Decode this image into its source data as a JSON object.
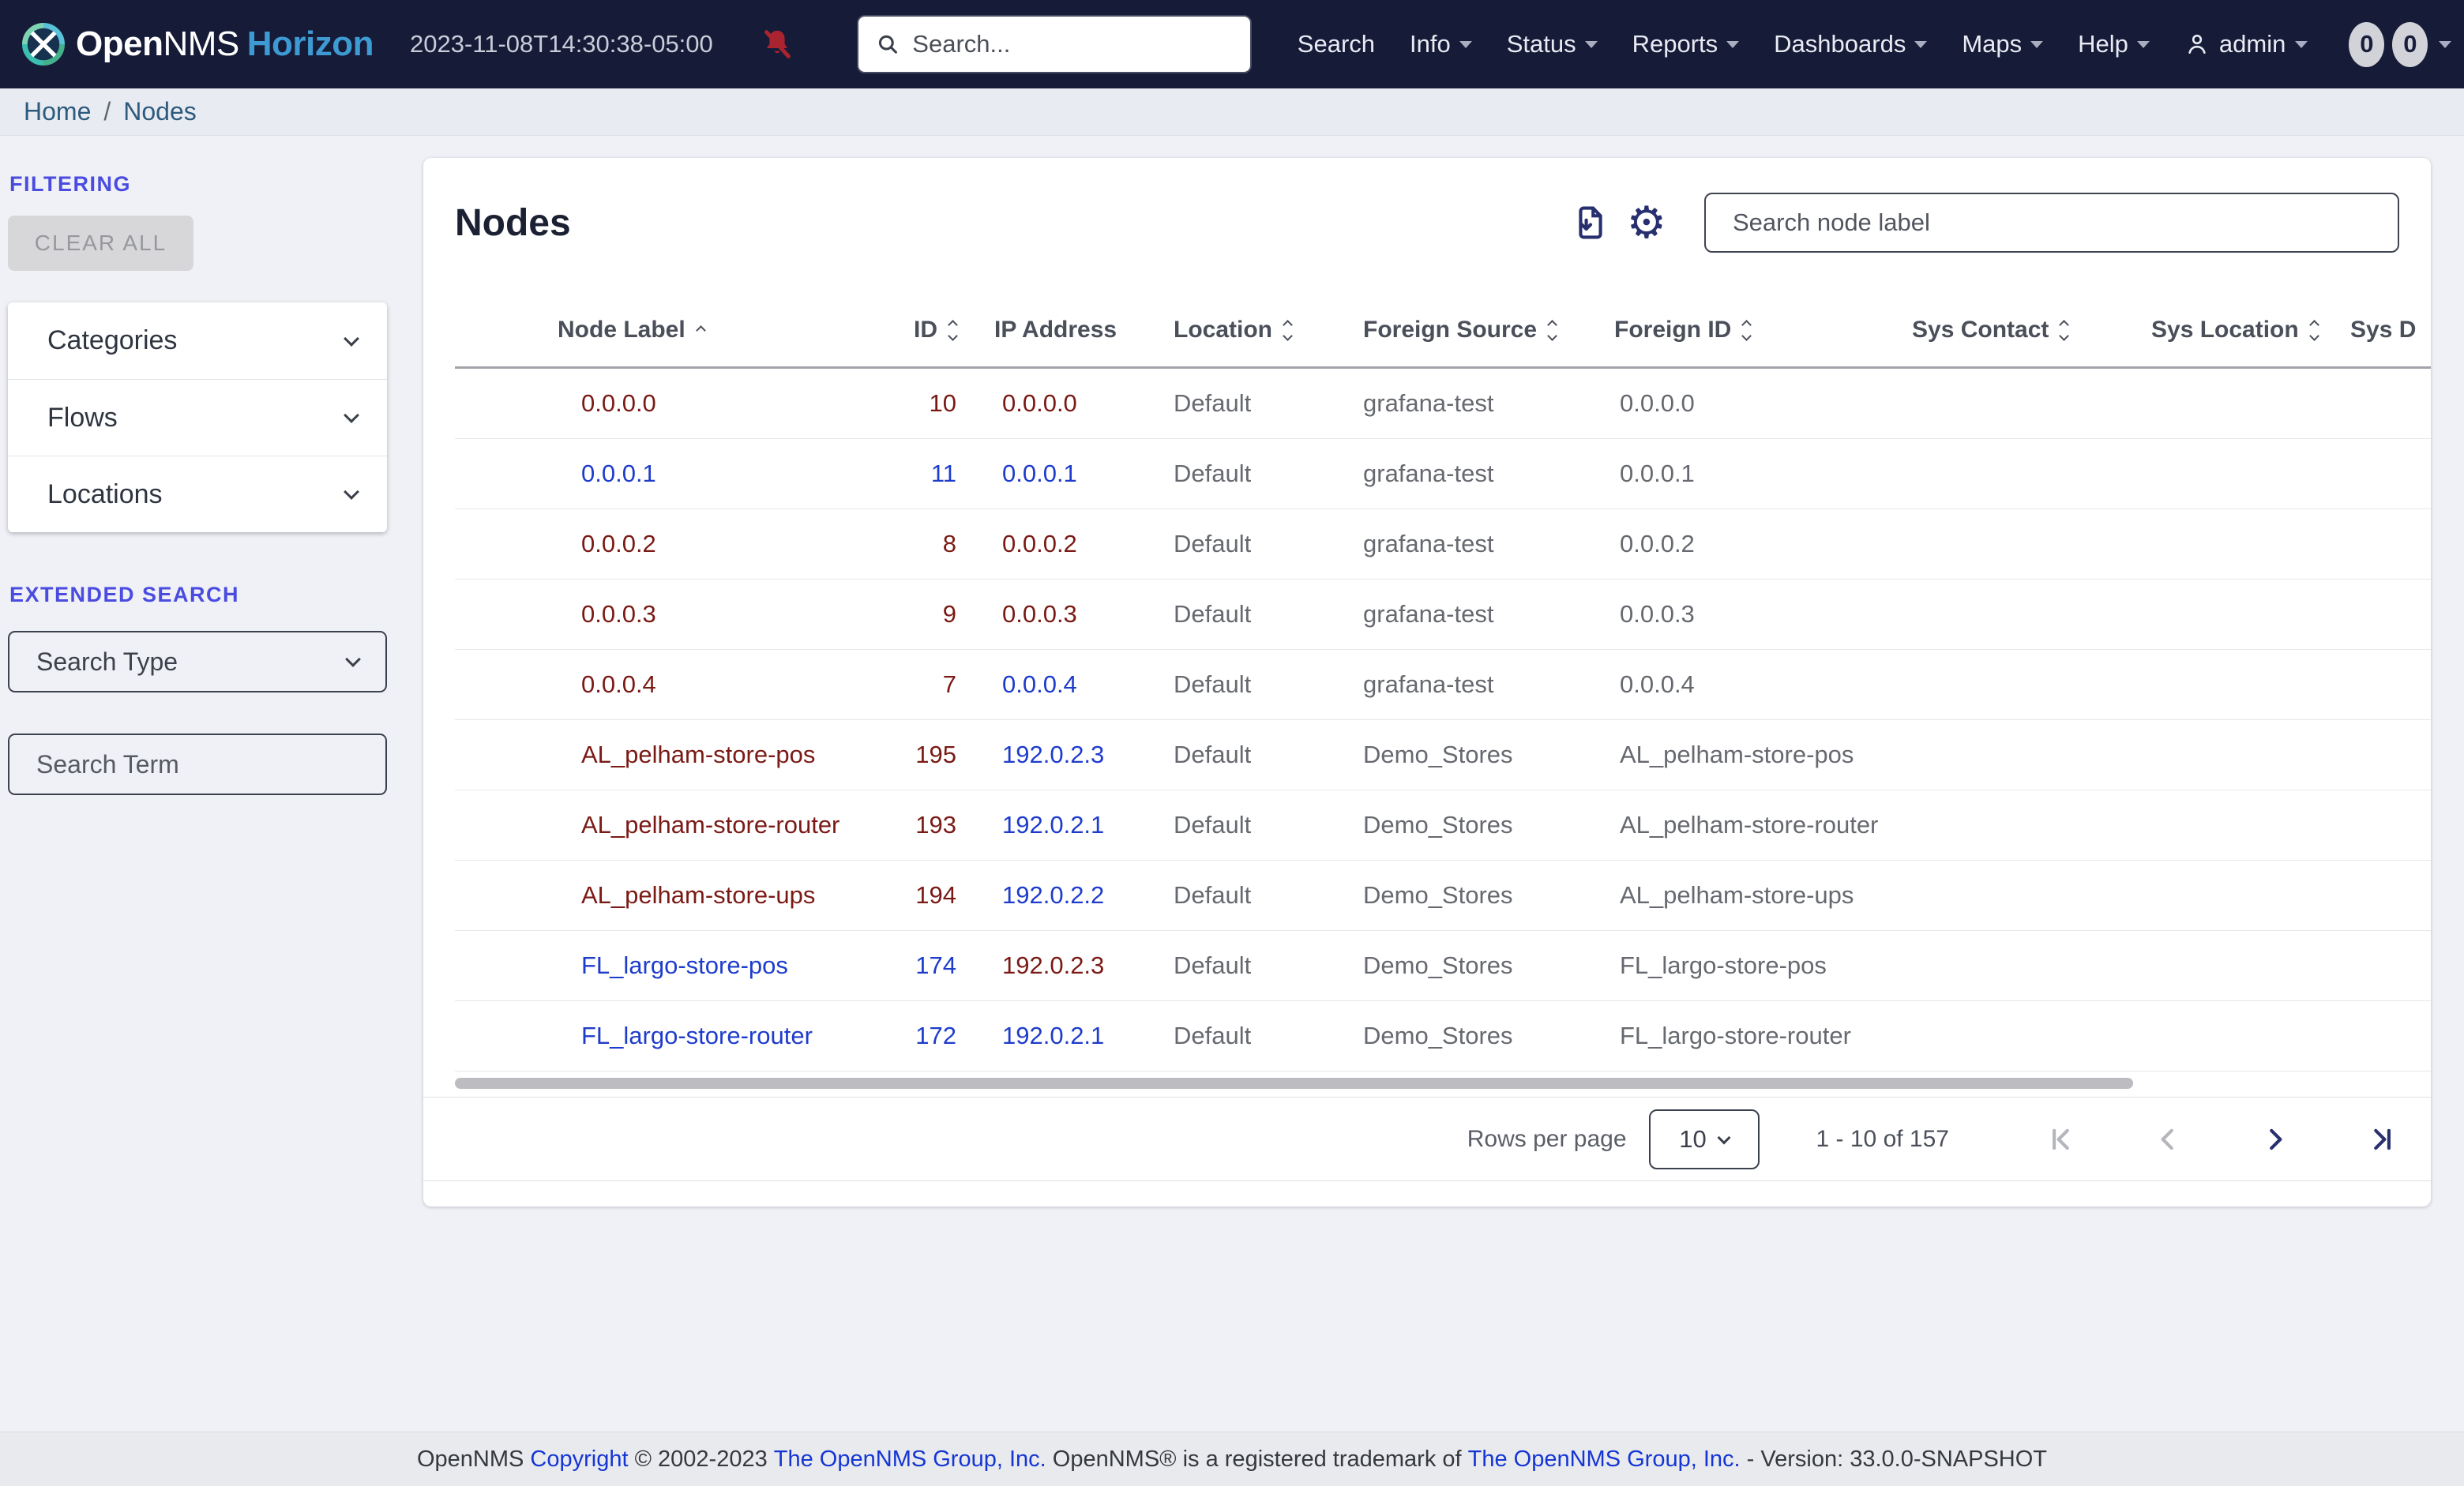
{
  "nav": {
    "brand": {
      "open": "Open",
      "nms": "NMS",
      "product": "Horizon"
    },
    "timestamp": "2023-11-08T14:30:38-05:00",
    "search_placeholder": "Search...",
    "menu": [
      {
        "label": "Search",
        "caret": false
      },
      {
        "label": "Info",
        "caret": true
      },
      {
        "label": "Status",
        "caret": true
      },
      {
        "label": "Reports",
        "caret": true
      },
      {
        "label": "Dashboards",
        "caret": true
      },
      {
        "label": "Maps",
        "caret": true
      },
      {
        "label": "Help",
        "caret": true
      }
    ],
    "user": {
      "label": "admin"
    },
    "badges": [
      "0",
      "0"
    ]
  },
  "breadcrumb": {
    "home": "Home",
    "separator": "/",
    "current": "Nodes"
  },
  "sidebar": {
    "filtering_label": "FILTERING",
    "clear_all_label": "CLEAR ALL",
    "accordions": [
      {
        "label": "Categories"
      },
      {
        "label": "Flows"
      },
      {
        "label": "Locations"
      }
    ],
    "extended_search_label": "EXTENDED SEARCH",
    "search_type_label": "Search Type",
    "search_term_placeholder": "Search Term"
  },
  "main": {
    "title": "Nodes",
    "node_search_placeholder": "Search node label",
    "table": {
      "columns": [
        {
          "label": "Node Label",
          "sort": "asc",
          "align": "left"
        },
        {
          "label": "ID",
          "sort": "both",
          "align": "right"
        },
        {
          "label": "IP Address",
          "sort": "none",
          "align": "left"
        },
        {
          "label": "Location",
          "sort": "both",
          "align": "left"
        },
        {
          "label": "Foreign Source",
          "sort": "both",
          "align": "left"
        },
        {
          "label": "Foreign ID",
          "sort": "both",
          "align": "left"
        },
        {
          "label": "Sys Contact",
          "sort": "both",
          "align": "left"
        },
        {
          "label": "Sys Location",
          "sort": "both",
          "align": "left"
        },
        {
          "label": "Sys D",
          "sort": "none",
          "align": "left"
        }
      ],
      "rows": [
        {
          "label": "0.0.0.0",
          "label_color": "red",
          "id": "10",
          "id_color": "red",
          "ip": "0.0.0.0",
          "ip_color": "red",
          "location": "Default",
          "foreign_source": "grafana-test",
          "foreign_id": "0.0.0.0",
          "sys_contact": "",
          "sys_location": "",
          "sys_description": ""
        },
        {
          "label": "0.0.0.1",
          "label_color": "blue",
          "id": "11",
          "id_color": "blue",
          "ip": "0.0.0.1",
          "ip_color": "blue",
          "location": "Default",
          "foreign_source": "grafana-test",
          "foreign_id": "0.0.0.1",
          "sys_contact": "",
          "sys_location": "",
          "sys_description": ""
        },
        {
          "label": "0.0.0.2",
          "label_color": "red",
          "id": "8",
          "id_color": "red",
          "ip": "0.0.0.2",
          "ip_color": "red",
          "location": "Default",
          "foreign_source": "grafana-test",
          "foreign_id": "0.0.0.2",
          "sys_contact": "",
          "sys_location": "",
          "sys_description": ""
        },
        {
          "label": "0.0.0.3",
          "label_color": "red",
          "id": "9",
          "id_color": "red",
          "ip": "0.0.0.3",
          "ip_color": "red",
          "location": "Default",
          "foreign_source": "grafana-test",
          "foreign_id": "0.0.0.3",
          "sys_contact": "",
          "sys_location": "",
          "sys_description": ""
        },
        {
          "label": "0.0.0.4",
          "label_color": "red",
          "id": "7",
          "id_color": "red",
          "ip": "0.0.0.4",
          "ip_color": "blue",
          "location": "Default",
          "foreign_source": "grafana-test",
          "foreign_id": "0.0.0.4",
          "sys_contact": "",
          "sys_location": "",
          "sys_description": ""
        },
        {
          "label": "AL_pelham-store-pos",
          "label_color": "red",
          "id": "195",
          "id_color": "red",
          "ip": "192.0.2.3",
          "ip_color": "blue",
          "location": "Default",
          "foreign_source": "Demo_Stores",
          "foreign_id": "AL_pelham-store-pos",
          "sys_contact": "",
          "sys_location": "",
          "sys_description": ""
        },
        {
          "label": "AL_pelham-store-router",
          "label_color": "red",
          "id": "193",
          "id_color": "red",
          "ip": "192.0.2.1",
          "ip_color": "blue",
          "location": "Default",
          "foreign_source": "Demo_Stores",
          "foreign_id": "AL_pelham-store-router",
          "sys_contact": "",
          "sys_location": "",
          "sys_description": ""
        },
        {
          "label": "AL_pelham-store-ups",
          "label_color": "red",
          "id": "194",
          "id_color": "red",
          "ip": "192.0.2.2",
          "ip_color": "blue",
          "location": "Default",
          "foreign_source": "Demo_Stores",
          "foreign_id": "AL_pelham-store-ups",
          "sys_contact": "",
          "sys_location": "",
          "sys_description": ""
        },
        {
          "label": "FL_largo-store-pos",
          "label_color": "blue",
          "id": "174",
          "id_color": "blue",
          "ip": "192.0.2.3",
          "ip_color": "red",
          "location": "Default",
          "foreign_source": "Demo_Stores",
          "foreign_id": "FL_largo-store-pos",
          "sys_contact": "",
          "sys_location": "",
          "sys_description": ""
        },
        {
          "label": "FL_largo-store-router",
          "label_color": "blue",
          "id": "172",
          "id_color": "blue",
          "ip": "192.0.2.1",
          "ip_color": "blue",
          "location": "Default",
          "foreign_source": "Demo_Stores",
          "foreign_id": "FL_largo-store-router",
          "sys_contact": "",
          "sys_location": "",
          "sys_description": ""
        }
      ]
    },
    "pagination": {
      "rows_per_page_label": "Rows per page",
      "page_size": "10",
      "range": "1 - 10 of 157"
    }
  },
  "footer": {
    "segments": [
      {
        "text": "OpenNMS ",
        "link": "false"
      },
      {
        "text": "Copyright",
        "link": "true"
      },
      {
        "text": " © 2002-2023 ",
        "link": "false"
      },
      {
        "text": "The OpenNMS Group, Inc.",
        "link": "true"
      },
      {
        "text": " OpenNMS® is a registered trademark of ",
        "link": "false"
      },
      {
        "text": "The OpenNMS Group, Inc.",
        "link": "true"
      },
      {
        "text": " - Version: 33.0.0-SNAPSHOT",
        "link": "false"
      }
    ]
  },
  "colors": {
    "navbar_bg": "#161b38",
    "accent_indigo": "#4a4ce0",
    "link_red": "#7a1a15",
    "link_blue": "#1e3ccc",
    "horizon_blue": "#3e9ad2",
    "bell_red": "#aa2430",
    "icon_navy": "#272f6e",
    "breadcrumb_link": "#2d5a7d"
  }
}
